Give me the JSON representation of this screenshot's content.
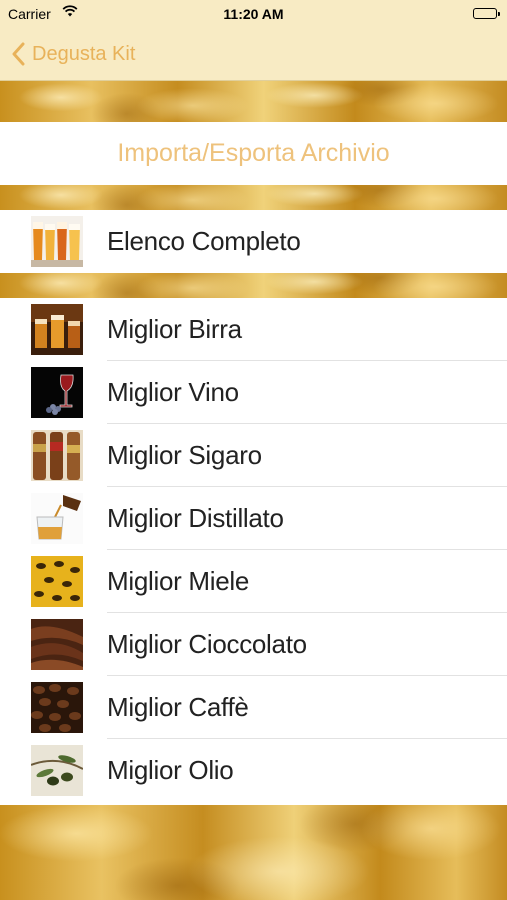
{
  "status_bar": {
    "carrier": "Carrier",
    "time": "11:20 AM",
    "wifi_icon": "wifi-icon",
    "battery_icon": "battery-icon"
  },
  "nav": {
    "back_label": "Degusta Kit",
    "back_icon": "chevron-left-icon",
    "accent_color": "#e8b25a"
  },
  "import_export": {
    "label": "Importa/Esporta Archivio",
    "color": "#eec27c"
  },
  "full_list": {
    "label": "Elenco Completo",
    "thumb": "beer-glasses-thumbnail"
  },
  "best_items": [
    {
      "label": "Miglior Birra",
      "thumb": "beer-thumbnail"
    },
    {
      "label": "Miglior Vino",
      "thumb": "wine-thumbnail"
    },
    {
      "label": "Miglior Sigaro",
      "thumb": "cigar-thumbnail"
    },
    {
      "label": "Miglior Distillato",
      "thumb": "spirits-thumbnail"
    },
    {
      "label": "Miglior Miele",
      "thumb": "honey-thumbnail"
    },
    {
      "label": "Miglior Cioccolato",
      "thumb": "chocolate-thumbnail"
    },
    {
      "label": "Miglior Caffè",
      "thumb": "coffee-thumbnail"
    },
    {
      "label": "Miglior Olio",
      "thumb": "olive-oil-thumbnail"
    }
  ],
  "colors": {
    "bar_background": "#f8ebc4",
    "gold_background": "#d9a640"
  }
}
